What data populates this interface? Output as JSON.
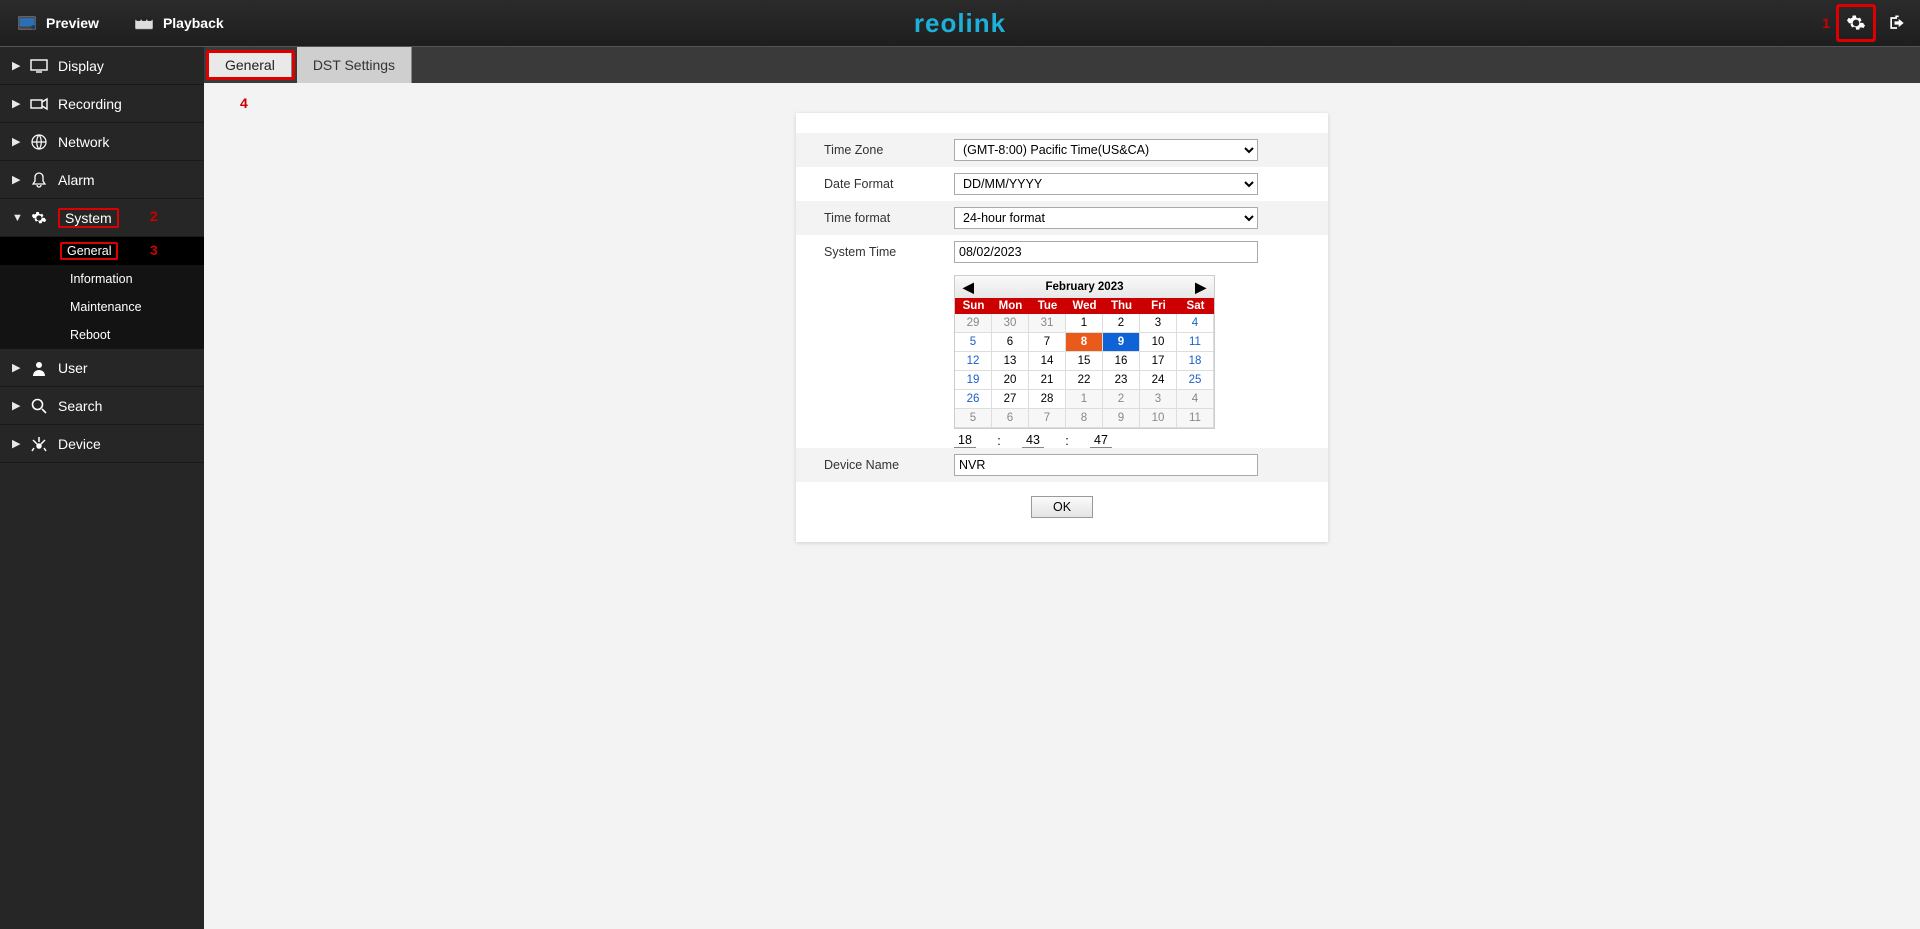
{
  "annotations": {
    "n1": "1",
    "n2": "2",
    "n3": "3",
    "n4": "4"
  },
  "topbar": {
    "preview": "Preview",
    "playback": "Playback",
    "logo": "reolink"
  },
  "sidebar": {
    "items": [
      {
        "label": "Display"
      },
      {
        "label": "Recording"
      },
      {
        "label": "Network"
      },
      {
        "label": "Alarm"
      },
      {
        "label": "System"
      },
      {
        "label": "User"
      },
      {
        "label": "Search"
      },
      {
        "label": "Device"
      }
    ],
    "system_sub": [
      {
        "label": "General"
      },
      {
        "label": "Information"
      },
      {
        "label": "Maintenance"
      },
      {
        "label": "Reboot"
      }
    ]
  },
  "tabs": {
    "general": "General",
    "dst": "DST Settings"
  },
  "form": {
    "timezone_label": "Time Zone",
    "timezone_value": "(GMT-8:00) Pacific Time(US&CA)",
    "dateformat_label": "Date Format",
    "dateformat_value": "DD/MM/YYYY",
    "timeformat_label": "Time format",
    "timeformat_value": "24-hour format",
    "systemtime_label": "System Time",
    "systemtime_value": "08/02/2023",
    "devicename_label": "Device Name",
    "devicename_value": "NVR",
    "ok": "OK"
  },
  "calendar": {
    "title": "February  2023",
    "dow": [
      "Sun",
      "Mon",
      "Tue",
      "Wed",
      "Thu",
      "Fri",
      "Sat"
    ],
    "weeks": [
      [
        {
          "d": "29",
          "cls": "other wknd"
        },
        {
          "d": "30",
          "cls": "other"
        },
        {
          "d": "31",
          "cls": "other"
        },
        {
          "d": "1",
          "cls": ""
        },
        {
          "d": "2",
          "cls": ""
        },
        {
          "d": "3",
          "cls": ""
        },
        {
          "d": "4",
          "cls": "wknd"
        }
      ],
      [
        {
          "d": "5",
          "cls": "wknd"
        },
        {
          "d": "6",
          "cls": ""
        },
        {
          "d": "7",
          "cls": ""
        },
        {
          "d": "8",
          "cls": "sel-orange"
        },
        {
          "d": "9",
          "cls": "sel-blue"
        },
        {
          "d": "10",
          "cls": ""
        },
        {
          "d": "11",
          "cls": "wknd"
        }
      ],
      [
        {
          "d": "12",
          "cls": "wknd"
        },
        {
          "d": "13",
          "cls": ""
        },
        {
          "d": "14",
          "cls": ""
        },
        {
          "d": "15",
          "cls": ""
        },
        {
          "d": "16",
          "cls": ""
        },
        {
          "d": "17",
          "cls": ""
        },
        {
          "d": "18",
          "cls": "wknd"
        }
      ],
      [
        {
          "d": "19",
          "cls": "wknd"
        },
        {
          "d": "20",
          "cls": ""
        },
        {
          "d": "21",
          "cls": ""
        },
        {
          "d": "22",
          "cls": ""
        },
        {
          "d": "23",
          "cls": ""
        },
        {
          "d": "24",
          "cls": ""
        },
        {
          "d": "25",
          "cls": "wknd"
        }
      ],
      [
        {
          "d": "26",
          "cls": "wknd"
        },
        {
          "d": "27",
          "cls": ""
        },
        {
          "d": "28",
          "cls": ""
        },
        {
          "d": "1",
          "cls": "other"
        },
        {
          "d": "2",
          "cls": "other"
        },
        {
          "d": "3",
          "cls": "other"
        },
        {
          "d": "4",
          "cls": "other wknd"
        }
      ],
      [
        {
          "d": "5",
          "cls": "other wknd"
        },
        {
          "d": "6",
          "cls": "other"
        },
        {
          "d": "7",
          "cls": "other"
        },
        {
          "d": "8",
          "cls": "other"
        },
        {
          "d": "9",
          "cls": "other"
        },
        {
          "d": "10",
          "cls": "other"
        },
        {
          "d": "11",
          "cls": "other wknd"
        }
      ]
    ]
  },
  "time": {
    "colon1": ":",
    "colon2": ":",
    "h": "18",
    "m": "43",
    "s": "47"
  }
}
